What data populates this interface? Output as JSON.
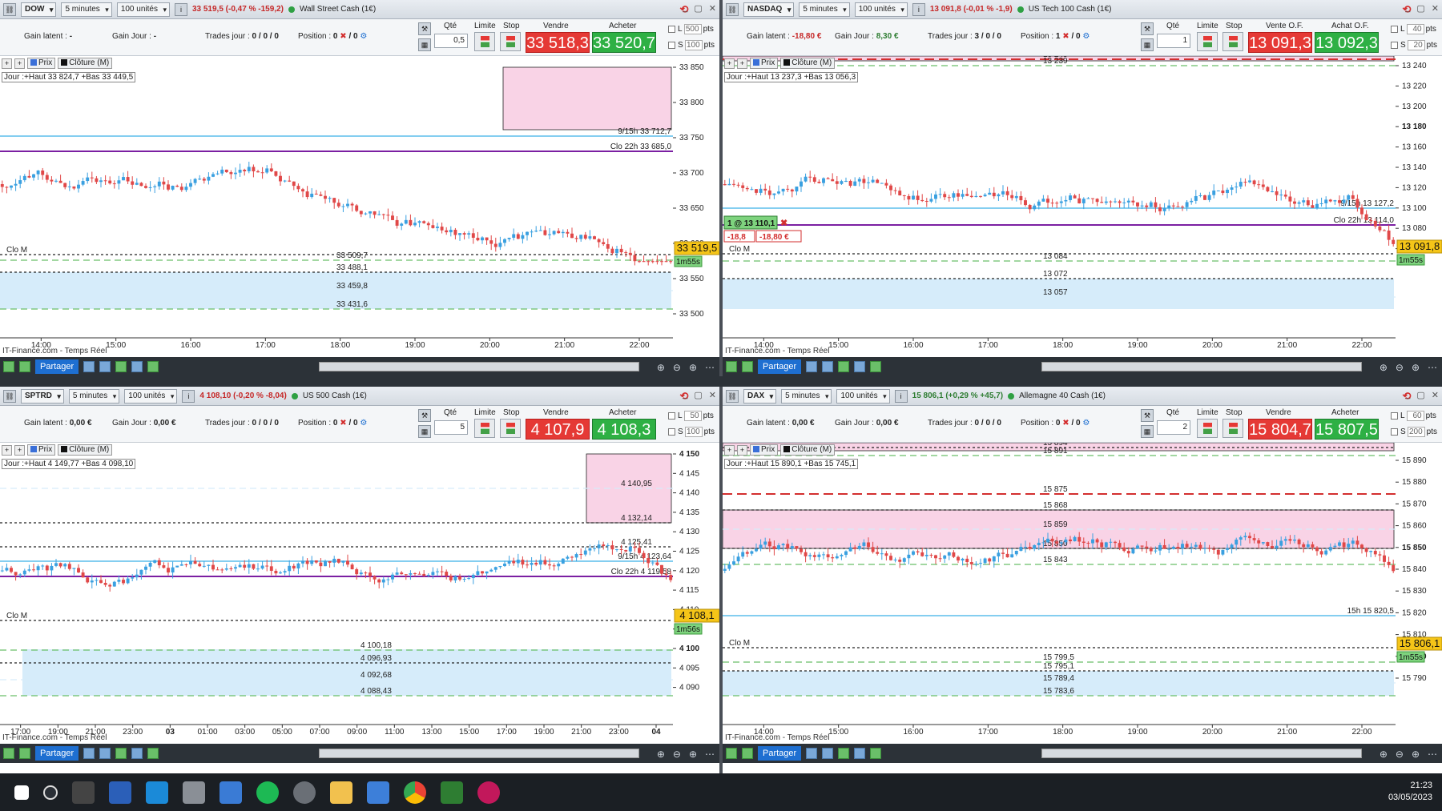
{
  "panels": [
    {
      "symbol": "DOW",
      "timeframe": "5 minutes",
      "units": "100 unités",
      "quote": "33 519,5 (-0,47 % -159,2)",
      "quote_up": false,
      "instrument": "Wall Street Cash (1€)",
      "gain_latent_label": "Gain latent :",
      "gain_latent": "-",
      "gain_jour_label": "Gain Jour :",
      "gain_jour": "-",
      "trades_label": "Trades jour :",
      "trades": "0 / 0 / 0",
      "position_label": "Position :",
      "position": "0",
      "position2": "/ 0",
      "qte_label": "Qté",
      "qte": "0,5",
      "limite_label": "Limite",
      "stop_label": "Stop",
      "sell_label": "Vendre",
      "sell": "33 518,3",
      "buy_label": "Acheter",
      "buy": "33 520,7",
      "l_label": "L",
      "l_pts": "500",
      "s_label": "S",
      "s_pts": "100",
      "pts": "pts",
      "prix": "Prix",
      "cloture": "Clôture (M)",
      "jour": "Jour :+Haut 33 824,7 +Bas 33 449,5",
      "source": "IT-Finance.com - Temps Réel",
      "price_tag": "33 519,5",
      "timer": "1m55s",
      "y_labels": [
        "33 850",
        "33 800",
        "33 750",
        "33 700",
        "33 650",
        "33 600",
        "33 550",
        "33 500"
      ],
      "x_labels": [
        "14:00",
        "15:00",
        "16:00",
        "17:00",
        "18:00",
        "19:00",
        "20:00",
        "21:00",
        "22:00"
      ],
      "level_labels": [
        "9/15h 33 712,7",
        "Clo 22h 33 685,0",
        "33 509,7",
        "33 488,1",
        "33 459,8",
        "33 431,6",
        "Clo M"
      ]
    },
    {
      "symbol": "NASDAQ",
      "timeframe": "5 minutes",
      "units": "100 unités",
      "quote": "13 091,8 (-0,01 % -1,9)",
      "quote_up": false,
      "instrument": "US Tech 100 Cash (1€)",
      "gain_latent_label": "Gain latent :",
      "gain_latent": "-18,80 €",
      "gain_jour_label": "Gain Jour :",
      "gain_jour": "8,30 €",
      "trades_label": "Trades jour :",
      "trades": "3 / 0 / 0",
      "position_label": "Position :",
      "position": "1",
      "position2": "/ 0",
      "qte_label": "Qté",
      "qte": "1",
      "limite_label": "Limite",
      "stop_label": "Stop",
      "sell_label": "Vente O.F.",
      "sell": "13 091,3",
      "buy_label": "Achat O.F.",
      "buy": "13 092,3",
      "l_label": "L",
      "l_pts": "40",
      "s_label": "S",
      "s_pts": "20",
      "pts": "pts",
      "prix": "Prix",
      "cloture": "Clôture (M)",
      "jour": "Jour :+Haut 13 237,3 +Bas 13 056,3",
      "source": "IT-Finance.com - Temps Réel",
      "price_tag": "13 091,8",
      "timer": "1m55s",
      "pos_tag": "1 @ 13 110,1",
      "pos_pl1": "-18,8",
      "pos_pl2": "-18,80 €",
      "y_labels": [
        "13 240",
        "13 220",
        "13 200",
        "13 180",
        "13 160",
        "13 140",
        "13 120",
        "13 100",
        "13 080",
        "13 060"
      ],
      "x_labels": [
        "14:00",
        "15:00",
        "16:00",
        "17:00",
        "18:00",
        "19:00",
        "20:00",
        "21:00",
        "22:00"
      ],
      "level_labels": [
        "13 245",
        "13 239",
        "9/15h 13 127,2",
        "Clo 22h 13 114,0",
        "13 084",
        "13 072",
        "13 057",
        "Clo M"
      ]
    },
    {
      "symbol": "SPTRD",
      "timeframe": "5 minutes",
      "units": "100 unités",
      "quote": "4 108,10 (-0,20 % -8,04)",
      "quote_up": false,
      "instrument": "US 500 Cash (1€)",
      "gain_latent_label": "Gain latent :",
      "gain_latent": "0,00 €",
      "gain_jour_label": "Gain Jour :",
      "gain_jour": "0,00 €",
      "trades_label": "Trades jour :",
      "trades": "0 / 0 / 0",
      "position_label": "Position :",
      "position": "0",
      "position2": "/ 0",
      "qte_label": "Qté",
      "qte": "5",
      "limite_label": "Limite",
      "stop_label": "Stop",
      "sell_label": "Vendre",
      "sell": "4 107,9",
      "buy_label": "Acheter",
      "buy": "4 108,3",
      "l_label": "L",
      "l_pts": "50",
      "s_label": "S",
      "s_pts": "100",
      "pts": "pts",
      "prix": "Prix",
      "cloture": "Clôture (M)",
      "jour": "Jour :+Haut 4 149,77 +Bas 4 098,10",
      "source": "IT-Finance.com - Temps Réel",
      "price_tag": "4 108,1",
      "timer": "1m56s",
      "y_labels": [
        "4 150",
        "4 145",
        "4 140",
        "4 135",
        "4 130",
        "4 125",
        "4 120",
        "4 115",
        "4 110",
        "4 105",
        "4 100",
        "4 095",
        "4 090"
      ],
      "x_labels": [
        "17:00",
        "19:00",
        "21:00",
        "23:00",
        "03",
        "01:00",
        "03:00",
        "05:00",
        "07:00",
        "09:00",
        "11:00",
        "13:00",
        "15:00",
        "17:00",
        "19:00",
        "21:00",
        "23:00",
        "04"
      ],
      "level_labels": [
        "4 149,77",
        "4 140,95",
        "4 132,14",
        "4 125,41",
        "9/15h 4 123,64",
        "Clo 22h 4 119,58",
        "4 100,18",
        "4 096,93",
        "4 092,68",
        "4 088,43",
        "Clo M"
      ]
    },
    {
      "symbol": "DAX",
      "timeframe": "5 minutes",
      "units": "100 unités",
      "quote": "15 806,1 (+0,29 % +45,7)",
      "quote_up": true,
      "instrument": "Allemagne 40 Cash (1€)",
      "gain_latent_label": "Gain latent :",
      "gain_latent": "0,00 €",
      "gain_jour_label": "Gain Jour :",
      "gain_jour": "0,00 €",
      "trades_label": "Trades jour :",
      "trades": "0 / 0 / 0",
      "position_label": "Position :",
      "position": "0",
      "position2": "/ 0",
      "qte_label": "Qté",
      "qte": "2",
      "limite_label": "Limite",
      "stop_label": "Stop",
      "sell_label": "Vendre",
      "sell": "15 804,7",
      "buy_label": "Acheter",
      "buy": "15 807,5",
      "l_label": "L",
      "l_pts": "60",
      "s_label": "S",
      "s_pts": "200",
      "pts": "pts",
      "prix": "Prix",
      "cloture": "Clôture (M)",
      "jour": "Jour :+Haut 15 890,1 +Bas 15 745,1",
      "source": "IT-Finance.com - Temps Réel",
      "price_tag": "15 806,1",
      "timer": "1m55s",
      "y_labels": [
        "15 890",
        "15 880",
        "15 870",
        "15 860",
        "15 850",
        "15 840",
        "15 830",
        "15 820",
        "15 810",
        "15 800",
        "15 790"
      ],
      "x_labels": [
        "14:00",
        "15:00",
        "16:00",
        "17:00",
        "18:00",
        "19:00",
        "20:00",
        "21:00",
        "22:00"
      ],
      "level_labels": [
        "15 894",
        "15 891",
        "15 875",
        "15 868",
        "15 859",
        "15 850",
        "15 843",
        "15h 15 820,5",
        "15 799,5",
        "15 795,1",
        "15 789,4",
        "15 783,6",
        "Clo M"
      ]
    }
  ],
  "bottom_bar": {
    "partager": "Partager"
  },
  "taskbar": {
    "time": "21:23",
    "date": "03/05/2023"
  },
  "colors": {
    "up": "#3aa0e0",
    "down": "#e04848",
    "sell": "#e53935",
    "buy": "#2eb044",
    "zone_pink": "#f9d3e6",
    "zone_blue": "#d6ecfa",
    "line_cyan": "#3ab0e8",
    "line_purple": "#7b1fa2"
  }
}
